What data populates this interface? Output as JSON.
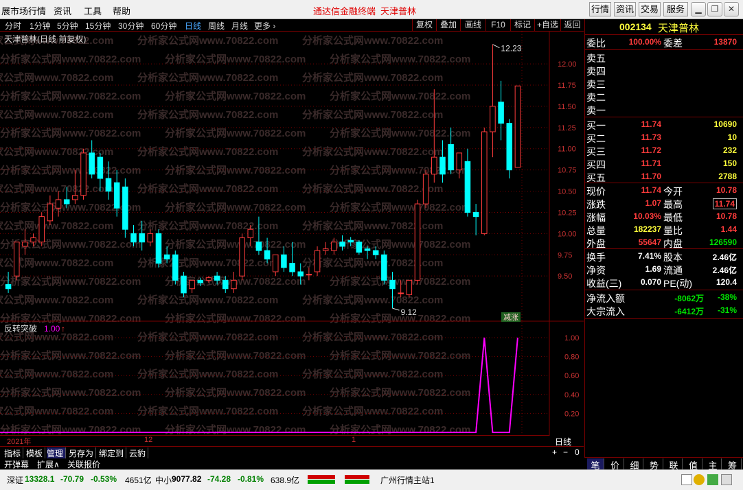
{
  "menu": {
    "items": [
      "展市场行情",
      "资讯",
      "工具",
      "帮助"
    ],
    "title_left": "通达信金融终端",
    "title_right": "天津普林",
    "right_buttons": [
      "行情",
      "资讯",
      "交易",
      "服务"
    ]
  },
  "periods": [
    "分时",
    "1分钟",
    "5分钟",
    "15分钟",
    "30分钟",
    "60分钟",
    "日线",
    "周线",
    "月线",
    "更多 ›"
  ],
  "active_period": "日线",
  "toolbar": [
    "复权",
    "叠加",
    "画线",
    "F10",
    "标记",
    "+自选",
    "返回"
  ],
  "chart": {
    "title": "天津普林(日线 前复权)",
    "high_label": "12.23",
    "low_label": "9.12",
    "badge": "减涨",
    "indicator_label": "反转突破",
    "indicator_value": "1.00",
    "price_ticks": [
      "12.00",
      "11.75",
      "11.50",
      "11.25",
      "11.00",
      "10.75",
      "10.50",
      "10.25",
      "10.00",
      "9.75",
      "9.50"
    ],
    "ind_ticks": [
      "1.00",
      "0.80",
      "0.60",
      "0.40",
      "0.20"
    ],
    "date_labels": [
      "2021年",
      "12",
      "1"
    ],
    "period_label": "日线",
    "watermark": "分析家公式网www.70822.com",
    "colors": {
      "up": "#ff3c3c",
      "down": "#00ffff",
      "indicator": "#ff00ff",
      "grid": "#7a0000"
    }
  },
  "chart_data": {
    "type": "candlestick",
    "ylim": [
      9.0,
      12.3
    ],
    "candles": [
      [
        9.4,
        9.55,
        9.35,
        9.3
      ],
      [
        9.5,
        9.9,
        9.9,
        9.45
      ],
      [
        9.85,
        10.05,
        9.9,
        9.75
      ],
      [
        9.9,
        10.0,
        9.95,
        9.85
      ],
      [
        9.9,
        10.25,
        10.2,
        9.85
      ],
      [
        10.15,
        10.45,
        10.35,
        10.1
      ],
      [
        10.3,
        10.5,
        10.4,
        10.2
      ],
      [
        10.4,
        10.55,
        10.35,
        10.3
      ],
      [
        10.4,
        10.75,
        10.45,
        10.35
      ],
      [
        10.45,
        11.0,
        10.95,
        10.4
      ],
      [
        10.95,
        11.1,
        10.7,
        10.65
      ],
      [
        10.9,
        10.95,
        10.65,
        10.5
      ],
      [
        10.65,
        10.85,
        10.5,
        10.4
      ],
      [
        10.6,
        10.75,
        10.3,
        10.2
      ],
      [
        10.55,
        10.65,
        10.05,
        9.95
      ],
      [
        10.0,
        10.1,
        9.9,
        9.85
      ],
      [
        10.0,
        10.15,
        9.9,
        9.8
      ],
      [
        9.9,
        10.05,
        10.0,
        9.85
      ],
      [
        10.0,
        10.05,
        9.65,
        9.6
      ],
      [
        9.75,
        9.85,
        9.7,
        9.65
      ],
      [
        9.75,
        9.8,
        9.45,
        9.4
      ],
      [
        9.5,
        9.55,
        9.3,
        9.25
      ],
      [
        9.35,
        9.45,
        9.45,
        9.3
      ],
      [
        9.45,
        9.48,
        9.42,
        9.38
      ],
      [
        9.45,
        9.5,
        9.48,
        9.42
      ],
      [
        9.5,
        9.55,
        9.45,
        9.4
      ],
      [
        9.45,
        9.5,
        9.35,
        9.3
      ],
      [
        9.35,
        9.55,
        9.45,
        9.3
      ],
      [
        9.5,
        10.0,
        9.95,
        9.45
      ],
      [
        9.95,
        10.1,
        10.05,
        9.85
      ],
      [
        9.9,
        10.2,
        9.8,
        9.75
      ],
      [
        9.8,
        9.95,
        9.7,
        9.65
      ],
      [
        9.55,
        9.75,
        9.75,
        9.5
      ],
      [
        9.75,
        9.85,
        9.6,
        9.55
      ],
      [
        9.65,
        9.9,
        9.55,
        9.5
      ],
      [
        9.55,
        9.65,
        9.5,
        9.4
      ],
      [
        9.52,
        9.6,
        9.52,
        9.45
      ],
      [
        9.55,
        9.85,
        9.8,
        9.5
      ],
      [
        9.8,
        9.9,
        9.82,
        9.75
      ],
      [
        9.8,
        9.95,
        9.9,
        9.75
      ],
      [
        9.9,
        9.98,
        9.85,
        9.8
      ],
      [
        9.92,
        9.96,
        9.9,
        9.85
      ],
      [
        9.9,
        9.92,
        9.78,
        9.75
      ],
      [
        9.82,
        9.85,
        9.8,
        9.7
      ],
      [
        9.8,
        9.85,
        9.75,
        9.7
      ],
      [
        9.75,
        9.8,
        9.45,
        9.4
      ],
      [
        9.45,
        9.55,
        9.35,
        9.12
      ],
      [
        9.3,
        9.45,
        9.3,
        9.25
      ],
      [
        9.28,
        9.45,
        9.45,
        9.25
      ],
      [
        9.45,
        10.4,
        10.35,
        9.4
      ],
      [
        10.35,
        10.75,
        10.7,
        10.3
      ],
      [
        10.7,
        11.7,
        10.9,
        10.6
      ],
      [
        10.9,
        11.1,
        10.7,
        10.6
      ],
      [
        11.05,
        11.25,
        10.75,
        10.7
      ],
      [
        10.75,
        10.95,
        10.95,
        10.65
      ],
      [
        10.85,
        11.0,
        10.25,
        10.2
      ],
      [
        10.25,
        10.35,
        10.2,
        9.98
      ],
      [
        10.0,
        11.25,
        11.2,
        9.98
      ],
      [
        11.2,
        12.23,
        11.5,
        10.9
      ],
      [
        11.55,
        11.8,
        11.3,
        11.1
      ],
      [
        11.3,
        11.35,
        10.75,
        10.65
      ],
      [
        10.78,
        11.74,
        11.74,
        10.78
      ]
    ],
    "indicator": {
      "name": "反转突破",
      "values": [
        0,
        0,
        0,
        0,
        0,
        0,
        0,
        0,
        0,
        0,
        0,
        0,
        0,
        0,
        0,
        0,
        0,
        0,
        0,
        0,
        0,
        0,
        0,
        0,
        0,
        0,
        0,
        0,
        0,
        0,
        0,
        0,
        0,
        0,
        0,
        0,
        0,
        0,
        0,
        0,
        0,
        0,
        0,
        0,
        0,
        0,
        0,
        0,
        0,
        0,
        0,
        0,
        0,
        0,
        0,
        0,
        0,
        1,
        0,
        0,
        0,
        1
      ],
      "ylim": [
        0,
        1
      ]
    }
  },
  "quote": {
    "code": "002134",
    "name": "天津普林",
    "weibi_label": "委比",
    "weibi": "100.00%",
    "weicha_label": "委差",
    "weicha": "13870",
    "sell": [
      {
        "label": "卖五",
        "price": "",
        "vol": ""
      },
      {
        "label": "卖四",
        "price": "",
        "vol": ""
      },
      {
        "label": "卖三",
        "price": "",
        "vol": ""
      },
      {
        "label": "卖二",
        "price": "",
        "vol": ""
      },
      {
        "label": "卖一",
        "price": "",
        "vol": ""
      }
    ],
    "buy": [
      {
        "label": "买一",
        "price": "11.74",
        "vol": "10690"
      },
      {
        "label": "买二",
        "price": "11.73",
        "vol": "10"
      },
      {
        "label": "买三",
        "price": "11.72",
        "vol": "232"
      },
      {
        "label": "买四",
        "price": "11.71",
        "vol": "150"
      },
      {
        "label": "买五",
        "price": "11.70",
        "vol": "2788"
      }
    ],
    "stats": [
      {
        "l": "现价",
        "v": "11.74",
        "vc": "red",
        "l2": "今开",
        "v2": "10.78",
        "v2c": "red"
      },
      {
        "l": "涨跌",
        "v": "1.07",
        "vc": "red",
        "l2": "最高",
        "v2": "11.74",
        "v2c": "red"
      },
      {
        "l": "涨幅",
        "v": "10.03%",
        "vc": "red",
        "l2": "最低",
        "v2": "10.78",
        "v2c": "red"
      },
      {
        "l": "总量",
        "v": "182237",
        "vc": "yellow",
        "l2": "量比",
        "v2": "1.44",
        "v2c": "red"
      },
      {
        "l": "外盘",
        "v": "55647",
        "vc": "red",
        "l2": "内盘",
        "v2": "126590",
        "v2c": "green"
      }
    ],
    "stats2": [
      {
        "l": "换手",
        "v": "7.41%",
        "l2": "股本",
        "v2": "2.46亿"
      },
      {
        "l": "净资",
        "v": "1.69",
        "l2": "流通",
        "v2": "2.46亿"
      },
      {
        "l": "收益(三)",
        "v": "0.070",
        "l2": "PE(动)",
        "v2": "120.4"
      }
    ],
    "flow": [
      {
        "l": "净流入额",
        "v": "-8062万",
        "p": "-38%"
      },
      {
        "l": "大宗流入",
        "v": "-6412万",
        "p": "-31%"
      }
    ],
    "tabs": [
      "笔",
      "价",
      "细",
      "势",
      "联",
      "值",
      "主",
      "筹"
    ]
  },
  "bottom": {
    "tabs": [
      "指标",
      "模板",
      "管理",
      "另存为",
      "绑定到",
      "云豹"
    ],
    "active_tab": "管理",
    "tabs2": [
      "开弹幕",
      "扩展∧",
      "关联报价"
    ],
    "controls": [
      "+",
      "−",
      "0"
    ]
  },
  "status": {
    "sz_label": "深证",
    "sz_val": "13328.1",
    "sz_chg": "-70.79",
    "sz_pct": "-0.53%",
    "sz_amt": "4651亿",
    "zx_label": "中小",
    "zx_val": "9077.82",
    "zx_chg": "-74.28",
    "zx_pct": "-0.81%",
    "zx_amt": "638.9亿",
    "station": "广州行情主站1"
  }
}
